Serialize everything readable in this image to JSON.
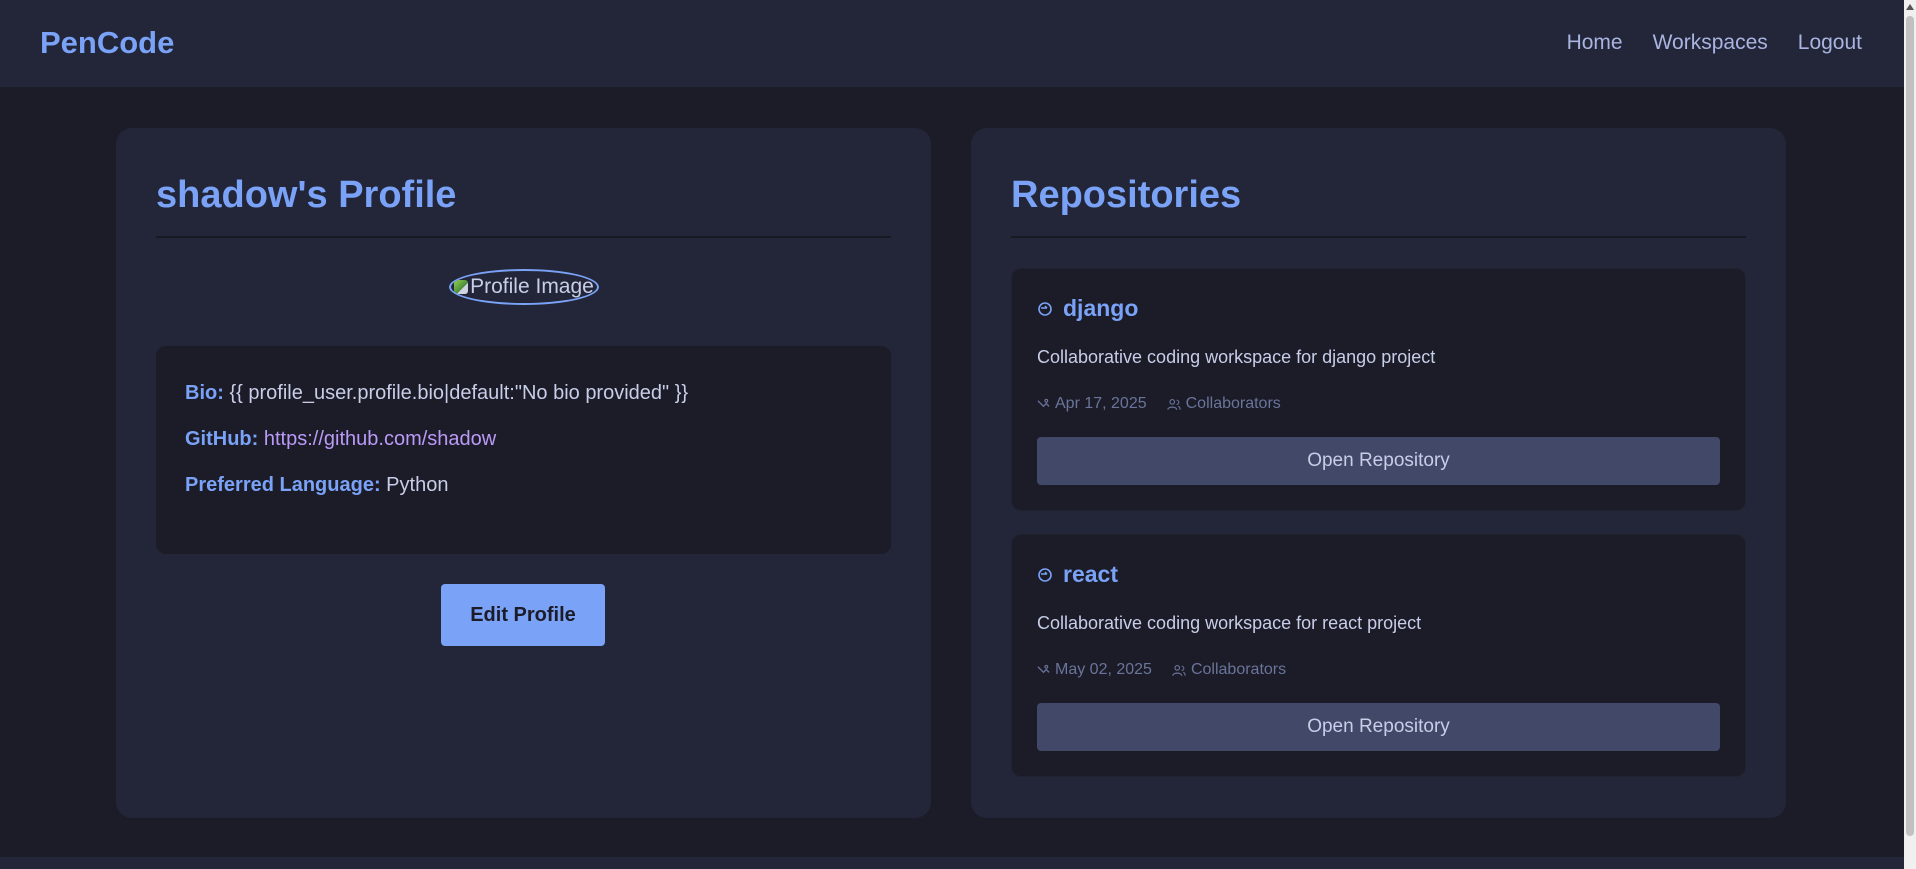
{
  "nav": {
    "brand": "PenCode",
    "links": [
      "Home",
      "Workspaces",
      "Logout"
    ]
  },
  "profile": {
    "title": "shadow's Profile",
    "image_alt": "Profile Image",
    "bio_label": "Bio:",
    "bio_value": "{{ profile_user.profile.bio|default:\"No bio provided\" }}",
    "github_label": "GitHub:",
    "github_value": "https://github.com/shadow",
    "language_label": "Preferred Language:",
    "language_value": "Python",
    "edit_button": "Edit Profile"
  },
  "repositories": {
    "title": "Repositories",
    "items": [
      {
        "name": "django",
        "description": "Collaborative coding workspace for django project",
        "date": "Apr 17, 2025",
        "collaborators": "Collaborators",
        "button": "Open Repository"
      },
      {
        "name": "react",
        "description": "Collaborative coding workspace for react project",
        "date": "May 02, 2025",
        "collaborators": "Collaborators",
        "button": "Open Repository"
      }
    ]
  },
  "colors": {
    "accent": "#7aa2f7",
    "link": "#bb9af7",
    "background": "#1b1c28",
    "card": "#222638",
    "button_secondary": "#414868"
  },
  "icons": {
    "repo": "git-branch-icon",
    "date": "calendar-icon",
    "collaborators": "users-icon"
  }
}
